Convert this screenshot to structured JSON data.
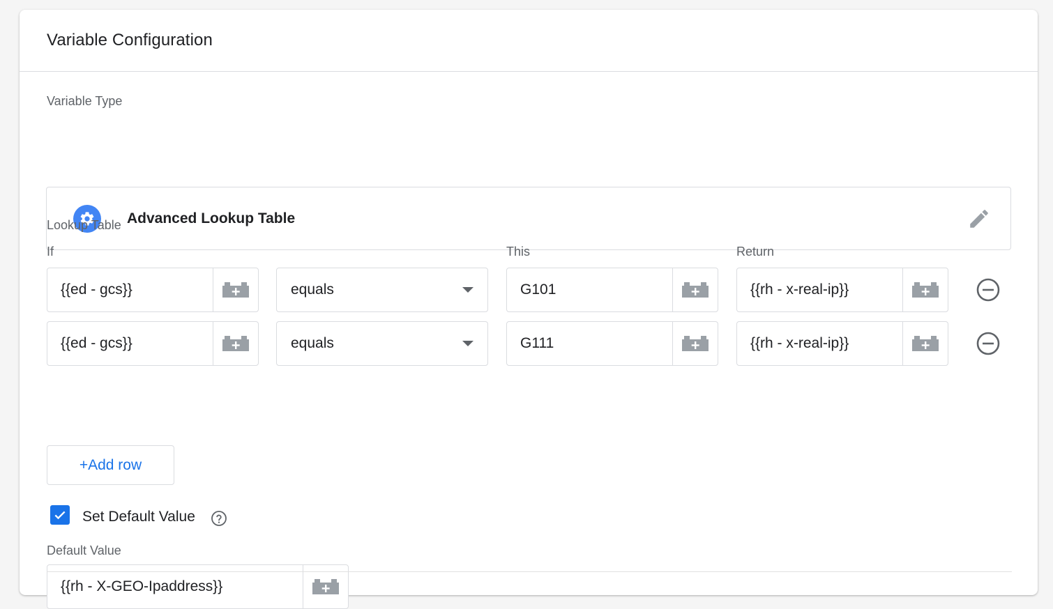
{
  "header": {
    "title": "Variable Configuration"
  },
  "variable_type": {
    "section_label": "Variable Type",
    "name": "Advanced Lookup Table",
    "icon": "gear-icon",
    "edit_icon": "pencil-icon"
  },
  "lookup_table": {
    "section_label": "Lookup Table",
    "columns": {
      "if": "If",
      "this": "This",
      "return": "Return"
    },
    "rows": [
      {
        "if_value": "{{ed - gcs}}",
        "operator": "equals",
        "this_value": "G101",
        "return_value": "{{rh - x-real-ip}}"
      },
      {
        "if_value": "{{ed - gcs}}",
        "operator": "equals",
        "this_value": "G111",
        "return_value": "{{rh - x-real-ip}}"
      }
    ],
    "add_row_label": "+Add row"
  },
  "default_value": {
    "checkbox_label": "Set Default Value",
    "checked": true,
    "field_label": "Default Value",
    "value": "{{rh - X-GEO-Ipaddress}}"
  },
  "colors": {
    "accent": "#1a73e8",
    "icon_blue": "#4285f4",
    "border": "#dadce0",
    "muted": "#5f6368"
  }
}
